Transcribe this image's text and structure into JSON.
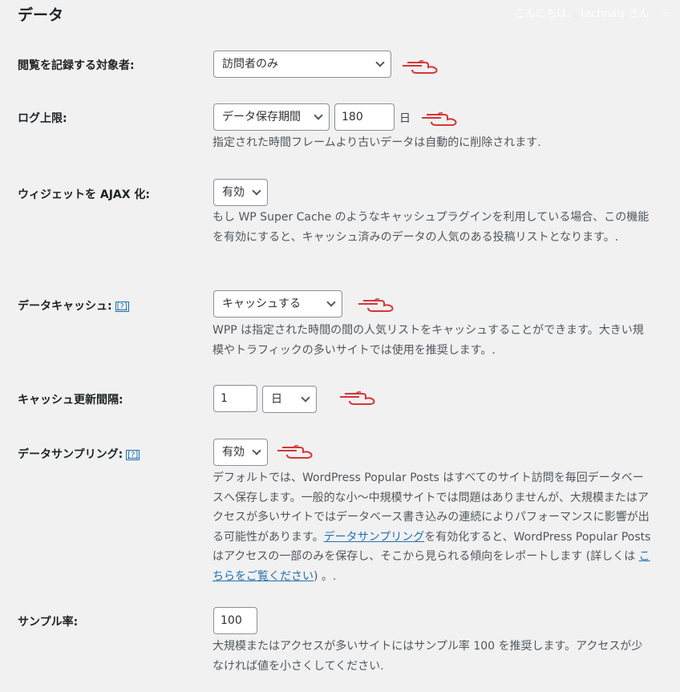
{
  "header": {
    "title": "データ",
    "greeting": "こんにちは、 technals さん",
    "more": "..."
  },
  "settings": {
    "log_target": {
      "label": "閲覧を記録する対象者:",
      "value": "訪問者のみ"
    },
    "log_limit": {
      "label": "ログ上限:",
      "select_value": "データ保存期間",
      "input_value": "180",
      "unit": "日",
      "description": "指定された時間フレームより古いデータは自動的に削除されます."
    },
    "ajax_widget": {
      "label": "ウィジェットを AJAX 化:",
      "value": "有効",
      "description": "もし WP Super Cache のようなキャッシュプラグインを利用している場合、この機能を有効にすると、キャッシュ済みのデータの人気のある投稿リストとなります。."
    },
    "data_cache": {
      "label": "データキャッシュ:",
      "help": "[?]",
      "value": "キャッシュする",
      "description": "WPP は指定された時間の間の人気リストをキャッシュすることができます。大きい規模やトラフィックの多いサイトでは使用を推奨します。."
    },
    "cache_interval": {
      "label": "キャッシュ更新間隔:",
      "input_value": "1",
      "select_value": "日"
    },
    "data_sampling": {
      "label": "データサンプリング:",
      "help": "[?]",
      "value": "有効",
      "description_1": "デフォルトでは、WordPress Popular Posts はすべてのサイト訪問を毎回データベースへ保存します。一般的な小～中規模サイトでは問題はありませんが、大規模またはアクセスが多いサイトではデータベース書き込みの連続によりパフォーマンスに影響が出る可能性があります。",
      "link_1": "データサンプリング",
      "description_2": "を有効化すると、WordPress Popular Posts はアクセスの一部のみを保存し、そこから見られる傾向をレポートします (詳しくは ",
      "link_2": "こちらをご覧ください",
      "description_3": ") 。."
    },
    "sample_rate": {
      "label": "サンプル率:",
      "input_value": "100",
      "description": "大規模またはアクセスが多いサイトにはサンプル率 100 を推奨します。アクセスが少なければ値を小さくしてください."
    }
  },
  "colors": {
    "background": "#f1f1f1",
    "link": "#2271b1",
    "pointer": "#d63638"
  }
}
